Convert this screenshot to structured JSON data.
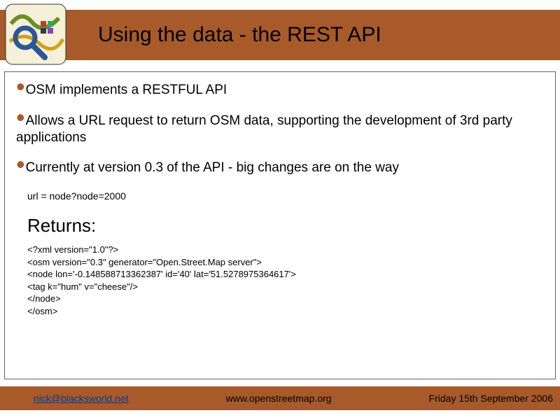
{
  "header": {
    "title": "Using the data - the REST API"
  },
  "bullets": {
    "b1": "OSM implements a RESTFUL API",
    "b2": "Allows a URL request to return OSM data, supporting the development of 3rd party applications",
    "b3": "Currently at version 0.3 of the API - big changes are on the way"
  },
  "code": {
    "url_line": "url = node?node=2000",
    "returns_label": "Returns:",
    "xml": "<?xml version=\"1.0\"?>\n<osm version=\"0.3\" generator=\"Open.Street.Map server\">\n<node lon='-0.148588713362387' id='40' lat='51.5278975364617'>\n  <tag k=\"hum\" v=\"cheese\"/>\n</node>\n</osm>"
  },
  "footer": {
    "email": "nick@blacksworld.net",
    "site": "www.openstreetmap.org",
    "date": "Friday 15th September 2006"
  }
}
